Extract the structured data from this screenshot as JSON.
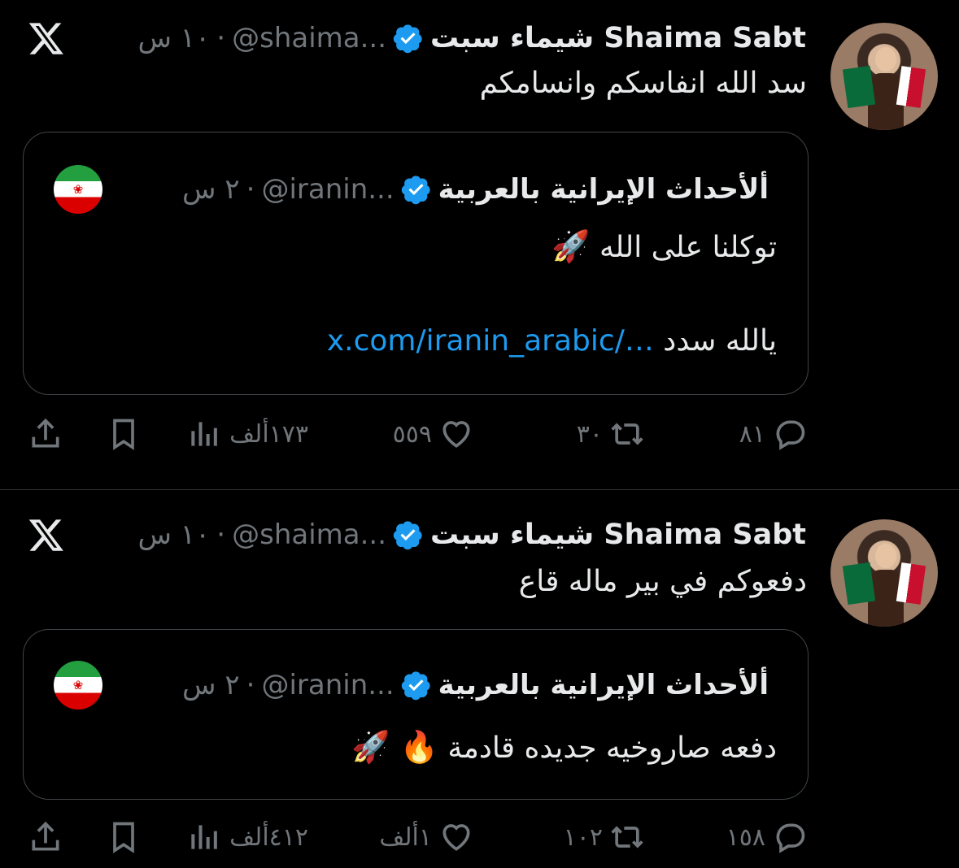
{
  "tweets": [
    {
      "author": {
        "name": "شيماء سبت Shaima Sabt",
        "handle": "@shaima...",
        "time": "١٠ س"
      },
      "text": "سد الله انفاسكم وانسامكم",
      "quote": {
        "author": {
          "name": "ألأحداث الإيرانية بالعربية",
          "handle": "@iranin...",
          "time": "٢ س"
        },
        "line1": "توكلنا على الله",
        "line1_emoji": "🚀",
        "line2_text": "يالله سدد",
        "line2_link": "x.com/iranin_arabic/…"
      },
      "actions": {
        "replies": "٨١",
        "reposts": "٣٠",
        "likes": "٥٥٩",
        "views": "١٧٣ألف"
      }
    },
    {
      "author": {
        "name": "شيماء سبت Shaima Sabt",
        "handle": "@shaima...",
        "time": "١٠ س"
      },
      "text": "دفعوكم في بير ماله قاع",
      "quote": {
        "author": {
          "name": "ألأحداث الإيرانية بالعربية",
          "handle": "@iranin...",
          "time": "٢ س"
        },
        "line1": "دفعه صاروخيه جديده قادمة",
        "line1_emoji": "🔥 🚀"
      },
      "actions": {
        "replies": "١٥٨",
        "reposts": "١٠٢",
        "likes": "١ألف",
        "views": "٤١٢ألف"
      }
    }
  ],
  "colors": {
    "background": "#000000",
    "text": "#e7e9ea",
    "muted": "#71767b",
    "link": "#1d9bf0",
    "verified": "#1d9bf0",
    "border": "#3f4448"
  }
}
